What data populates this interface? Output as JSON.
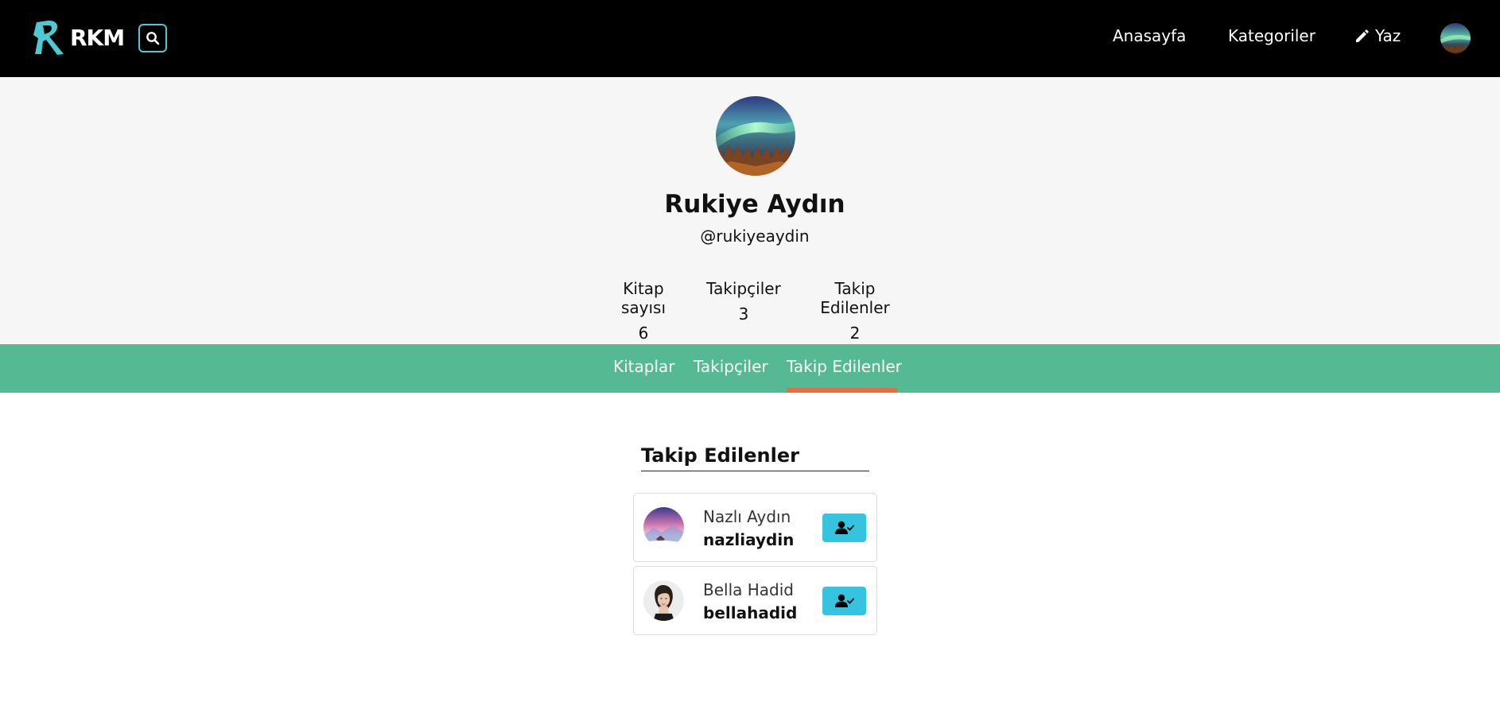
{
  "brand": {
    "name": "RKM",
    "logo_icon": "rkm-logo-icon"
  },
  "nav": {
    "search_icon": "search-icon",
    "home": "Anasayfa",
    "categories": "Kategoriler",
    "write": "Yaz",
    "write_icon": "pencil-icon"
  },
  "profile": {
    "name": "Rukiye Aydın",
    "handle": "@rukiyeaydin",
    "stats": {
      "books_label": "Kitap sayısı",
      "books_value": "6",
      "followers_label": "Takipçiler",
      "followers_value": "3",
      "following_label": "Takip Edilenler",
      "following_value": "2"
    }
  },
  "tabs": {
    "books": "Kitaplar",
    "followers": "Takipçiler",
    "following": "Takip Edilenler",
    "active": "following"
  },
  "section": {
    "title": "Takip Edilenler"
  },
  "following_list": [
    {
      "name": "Nazlı Aydın",
      "username": "nazliaydin",
      "action_icon": "user-check-icon"
    },
    {
      "name": "Bella Hadid",
      "username": "bellahadid",
      "action_icon": "user-check-icon"
    }
  ],
  "colors": {
    "navbar": "#000000",
    "accent_cyan": "#36c3df",
    "tabs_bg": "#55b994",
    "tab_indicator": "#f0683c",
    "profile_bg": "#f6f6f6"
  }
}
